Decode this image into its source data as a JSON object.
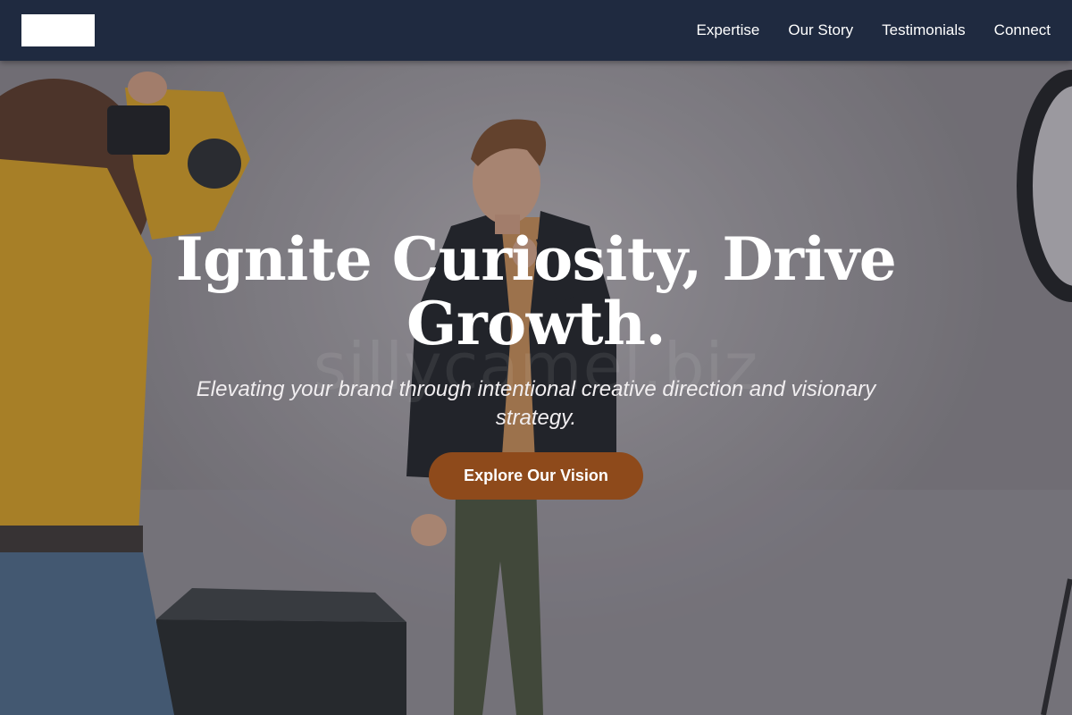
{
  "header": {
    "logo_alt": "",
    "nav": [
      {
        "label": "Expertise"
      },
      {
        "label": "Our Story"
      },
      {
        "label": "Testimonials"
      },
      {
        "label": "Connect"
      }
    ]
  },
  "hero": {
    "title": "Ignite Curiosity, Drive Growth.",
    "subtitle": "Elevating your brand through intentional creative direction and visionary strategy.",
    "cta_label": "Explore Our Vision",
    "watermark": "sillycamel.biz"
  },
  "colors": {
    "navbar": "#1f2a40",
    "cta": "#8e4a1b",
    "text": "#ffffff"
  }
}
